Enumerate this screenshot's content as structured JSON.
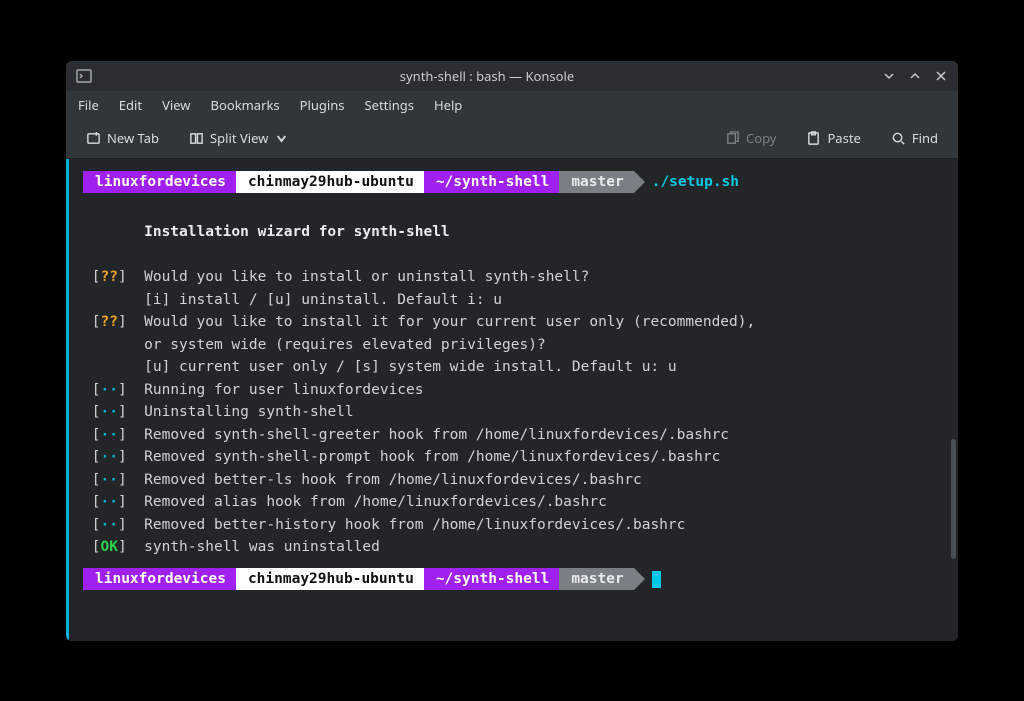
{
  "window": {
    "title": "synth-shell : bash — Konsole"
  },
  "menubar": {
    "file": "File",
    "edit": "Edit",
    "view": "View",
    "bookmarks": "Bookmarks",
    "plugins": "Plugins",
    "settings": "Settings",
    "help": "Help"
  },
  "toolbar": {
    "newtab": "New Tab",
    "splitview": "Split View",
    "copy": "Copy",
    "paste": "Paste",
    "find": "Find"
  },
  "prompt": {
    "user": "linuxfordevices",
    "host": "chinmay29hub-ubuntu",
    "path": "~/synth-shell",
    "branch": "master"
  },
  "command": "./setup.sh",
  "output": {
    "title": "Installation wizard for synth-shell",
    "lines": [
      {
        "tag": "??",
        "text": "Would you like to install or uninstall synth-shell?"
      },
      {
        "tag": "",
        "text": "[i] install / [u] uninstall. Default i: u"
      },
      {
        "tag": "??",
        "text": "Would you like to install it for your current user only (recommended),"
      },
      {
        "tag": "",
        "text": "or system wide (requires elevated privileges)?"
      },
      {
        "tag": "",
        "text": "[u] current user only / [s] system wide install. Default u: u"
      },
      {
        "tag": "··",
        "text": "Running for user linuxfordevices"
      },
      {
        "tag": "··",
        "text": "Uninstalling synth-shell"
      },
      {
        "tag": "··",
        "text": "Removed synth-shell-greeter hook from /home/linuxfordevices/.bashrc"
      },
      {
        "tag": "··",
        "text": "Removed synth-shell-prompt hook from /home/linuxfordevices/.bashrc"
      },
      {
        "tag": "··",
        "text": "Removed better-ls hook from /home/linuxfordevices/.bashrc"
      },
      {
        "tag": "··",
        "text": "Removed alias hook from /home/linuxfordevices/.bashrc"
      },
      {
        "tag": "··",
        "text": "Removed better-history hook from /home/linuxfordevices/.bashrc"
      },
      {
        "tag": "OK",
        "text": "synth-shell was uninstalled"
      }
    ]
  }
}
